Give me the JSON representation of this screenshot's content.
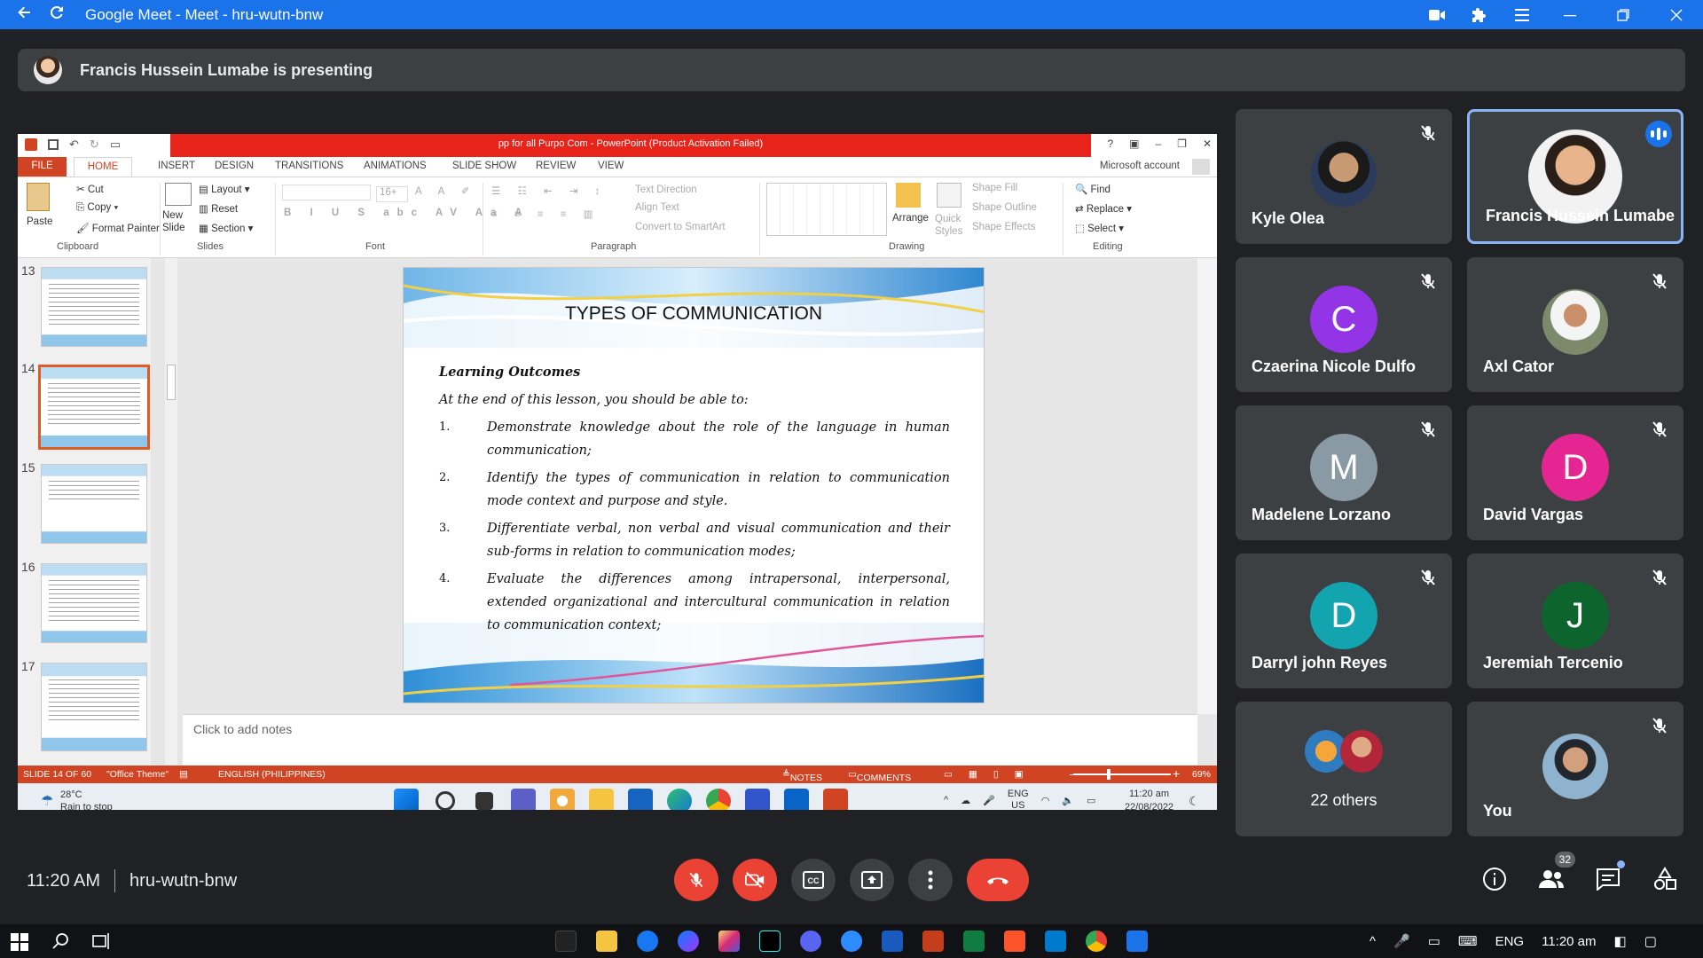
{
  "browser": {
    "title": "Google Meet - Meet - hru-wutn-bnw"
  },
  "presenting": {
    "text": "Francis Hussein Lumabe is presenting"
  },
  "powerpoint": {
    "window_title": "pp for all Purpo Com - PowerPoint (Product Activation Failed)",
    "tabs": [
      "FILE",
      "HOME",
      "INSERT",
      "DESIGN",
      "TRANSITIONS",
      "ANIMATIONS",
      "SLIDE SHOW",
      "REVIEW",
      "VIEW"
    ],
    "account": "Microsoft account",
    "ribbon": {
      "paste": "Paste",
      "cut": "Cut",
      "copy": "Copy",
      "format_painter": "Format Painter",
      "clipboard": "Clipboard",
      "new_slide": "New Slide",
      "layout": "Layout",
      "reset": "Reset",
      "section": "Section",
      "slides": "Slides",
      "font_size": "16+",
      "font": "Font",
      "text_direction": "Text Direction",
      "align_text": "Align Text",
      "convert_smartart": "Convert to SmartArt",
      "paragraph": "Paragraph",
      "arrange": "Arrange",
      "quick_styles": "Quick Styles",
      "shape_fill": "Shape Fill",
      "shape_outline": "Shape Outline",
      "shape_effects": "Shape Effects",
      "drawing": "Drawing",
      "find": "Find",
      "replace": "Replace",
      "select": "Select",
      "editing": "Editing"
    },
    "thumbnail_numbers": [
      "13",
      "14",
      "15",
      "16",
      "17"
    ],
    "slide": {
      "title": "TYPES OF COMMUNICATION",
      "heading": "Learning Outcomes",
      "intro": "At the end of this lesson, you should be able to:",
      "items": [
        {
          "n": "1.",
          "text": "Demonstrate knowledge about the role of the language in human communication;"
        },
        {
          "n": "2.",
          "text": "Identify the types of communication in relation to communication mode context and purpose and style."
        },
        {
          "n": "3.",
          "text": "Differentiate verbal, non verbal and visual communication and their sub-forms in relation to communication modes;"
        },
        {
          "n": "4.",
          "text": "Evaluate the differences among intrapersonal, interpersonal, extended organizational and intercultural communication in relation to communication context;"
        }
      ]
    },
    "notes_placeholder": "Click to add notes",
    "status": {
      "slide": "SLIDE 14 OF 60",
      "theme": "\"Office Theme\"",
      "language": "ENGLISH (PHILIPPINES)",
      "notes": "NOTES",
      "comments": "COMMENTS",
      "zoom": "69%"
    },
    "inner_taskbar": {
      "temp": "28°C",
      "weather": "Rain to stop",
      "lang1": "ENG",
      "lang2": "US",
      "time": "11:20 am",
      "date": "22/08/2022"
    }
  },
  "participants": [
    {
      "name": "Kyle Olea"
    },
    {
      "name": "Francis Hussein Lumabe"
    },
    {
      "name": "Czaerina Nicole Dulfo",
      "initial": "C"
    },
    {
      "name": "Axl Cator"
    },
    {
      "name": "Madelene Lorzano",
      "initial": "M"
    },
    {
      "name": "David Vargas",
      "initial": "D"
    },
    {
      "name": "Darryl john Reyes",
      "initial": "D"
    },
    {
      "name": "Jeremiah Tercenio",
      "initial": "J"
    },
    {
      "name": "22 others"
    },
    {
      "name": "You"
    }
  ],
  "colors": {
    "meet_bg": "#202124",
    "tile_bg": "#3c4043",
    "accent_blue": "#1a73e8",
    "mic_off_red": "#ea4335",
    "pp_orange": "#d04423"
  },
  "meeting": {
    "time": "11:20 AM",
    "code": "hru-wutn-bnw",
    "participant_count": "32"
  },
  "windows": {
    "lang": "ENG",
    "time": "11:20 am"
  }
}
